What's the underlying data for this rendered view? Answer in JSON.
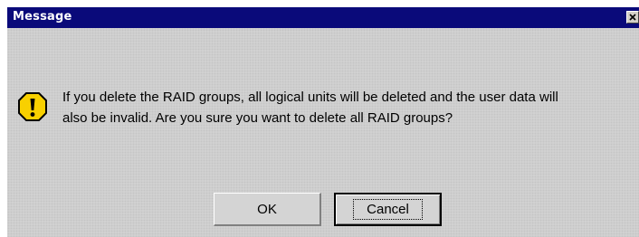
{
  "window": {
    "title": "Message",
    "close_label": "Close"
  },
  "message": {
    "lines": [
      "If you delete the RAID groups, all logical units will be deleted and the user data will",
      "also be invalid. Are you sure you want to delete all RAID groups?"
    ],
    "icon": "warning-icon"
  },
  "buttons": {
    "ok_label": "OK",
    "cancel_label": "Cancel"
  },
  "colors": {
    "title_bar": "#0a0a7a",
    "dialog_background": "#d4d4d4",
    "icon_fill": "#f8d000"
  }
}
